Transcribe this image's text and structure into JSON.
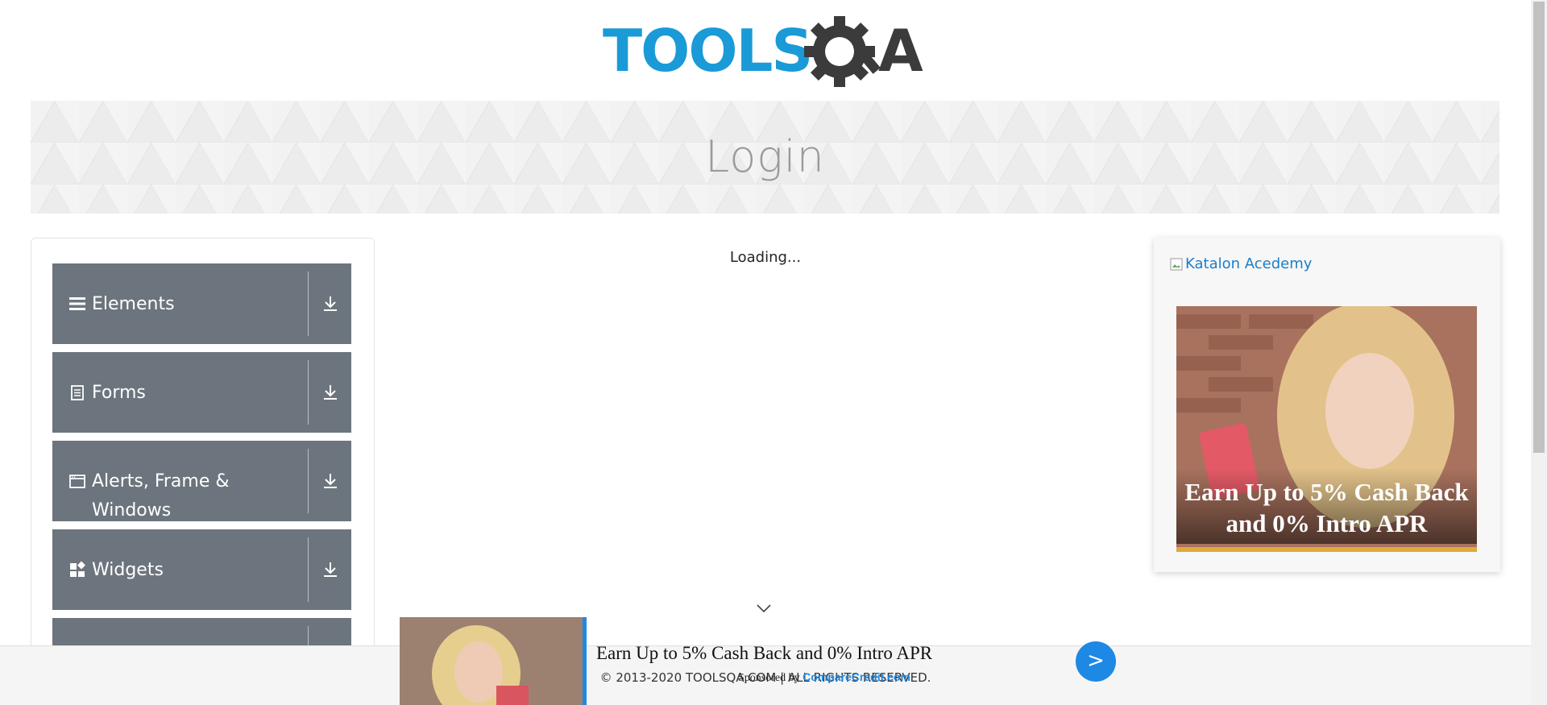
{
  "header": {
    "logo_text_left": "TOOLS",
    "logo_text_right": "A"
  },
  "banner": {
    "title": "Login"
  },
  "sidebar": {
    "groups": [
      {
        "label": "Elements",
        "icon": "hamburger-icon"
      },
      {
        "label": "Forms",
        "icon": "document-icon"
      },
      {
        "label": "Alerts, Frame & Windows",
        "icon": "window-icon"
      },
      {
        "label": "Widgets",
        "icon": "widgets-icon"
      },
      {
        "label": "",
        "icon": ""
      }
    ]
  },
  "main": {
    "loading_text": "Loading..."
  },
  "right_ad": {
    "image_alt": "Katalon Acedemy",
    "caption": "Earn Up to 5% Cash Back and 0% Intro APR"
  },
  "bottom_ad": {
    "headline": "Earn Up to 5% Cash Back and 0% Intro APR",
    "sponsored_prefix": "Sponsored by",
    "sponsor_name": "CompareCredit.com",
    "button_label": ">"
  },
  "footer": {
    "copyright": "© 2013-2020 TOOLSQA.COM | ALL RIGHTS RESERVED."
  },
  "colors": {
    "logo_blue": "#1a9ad6",
    "logo_dark": "#3b3b3b",
    "group_bg": "#6c757d",
    "accent_blue": "#1e88e5",
    "ad_bar": "#e0a93c"
  }
}
